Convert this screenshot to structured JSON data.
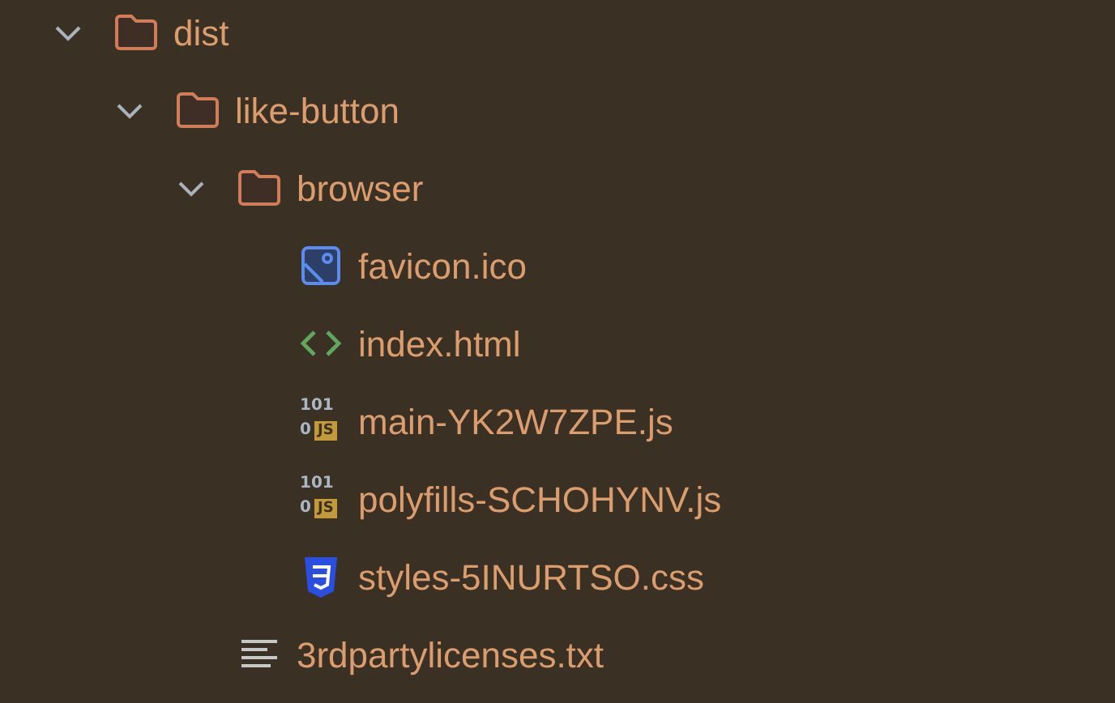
{
  "tree": [
    {
      "kind": "folder",
      "label": "dist",
      "expanded": true,
      "children": [
        {
          "kind": "folder",
          "label": "like-button",
          "expanded": true,
          "children": [
            {
              "kind": "folder",
              "label": "browser",
              "expanded": true,
              "children": [
                {
                  "kind": "image",
                  "label": "favicon.ico"
                },
                {
                  "kind": "html",
                  "label": "index.html"
                },
                {
                  "kind": "js",
                  "label": "main-YK2W7ZPE.js",
                  "icon_bits": [
                    "101",
                    "0"
                  ],
                  "icon_badge": "JS"
                },
                {
                  "kind": "js",
                  "label": "polyfills-SCHOHYNV.js",
                  "icon_bits": [
                    "101",
                    "0"
                  ],
                  "icon_badge": "JS"
                },
                {
                  "kind": "css",
                  "label": "styles-5INURTSO.css"
                }
              ]
            },
            {
              "kind": "text",
              "label": "3rdpartylicenses.txt"
            }
          ]
        }
      ]
    }
  ]
}
